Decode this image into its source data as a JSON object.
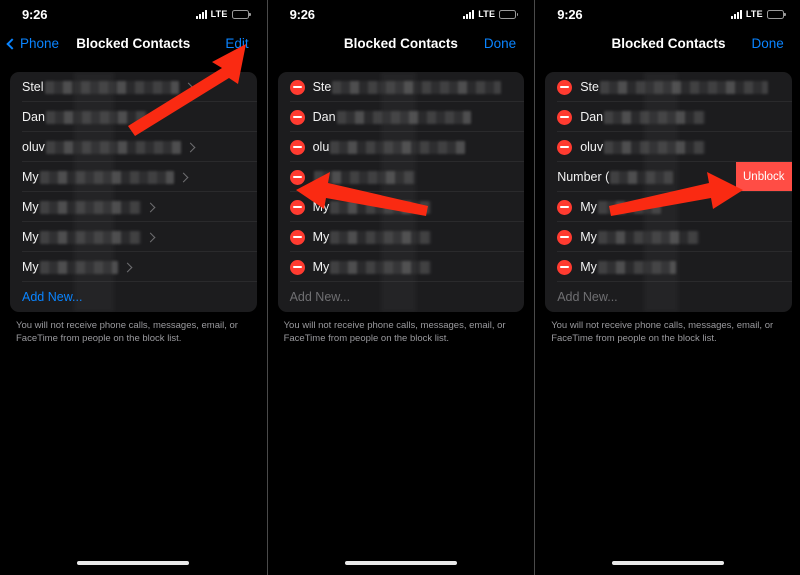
{
  "meta": {
    "panel_count": 3,
    "accent_blue": "#0a84ff",
    "destructive_red": "#ff3b30",
    "unblock_red": "#ff4d45",
    "list_bg": "#1c1c1e",
    "screen_bg": "#000000",
    "annotation_arrow_color": "#fa2a12"
  },
  "status_bar": {
    "time": "9:26",
    "network": "LTE",
    "signal_icon": "cellular-signal-icon",
    "battery_icon": "battery-low-power-icon",
    "battery_level_percent": 48
  },
  "footer_note": "You will not receive phone calls, messages, email, or FaceTime from people on the block list.",
  "panels": [
    {
      "id": "panel-view-mode",
      "nav": {
        "back_label": "Phone",
        "back_icon": "chevron-left-icon",
        "title": "Blocked Contacts",
        "action_label": "Edit",
        "has_back": true
      },
      "edit_mode": false,
      "add_new_label": "Add New...",
      "add_new_enabled": true,
      "rows": [
        {
          "label": "Stel",
          "redacted": true,
          "redact_width": "w60",
          "accessory": "chevron-right-icon"
        },
        {
          "label": "Dan",
          "redacted": true,
          "redact_width": "w45",
          "accessory": "chevron-right-icon"
        },
        {
          "label": "oluv",
          "redacted": true,
          "redact_width": "w60",
          "accessory": "chevron-right-icon"
        },
        {
          "label": "My",
          "redacted": true,
          "redact_width": "w60",
          "accessory": "chevron-right-icon"
        },
        {
          "label": "My",
          "redacted": true,
          "redact_width": "w45",
          "accessory": "chevron-right-icon"
        },
        {
          "label": "My",
          "redacted": true,
          "redact_width": "w45",
          "accessory": "chevron-right-icon"
        },
        {
          "label": "My",
          "redacted": true,
          "redact_width": "w35",
          "accessory": "chevron-right-icon"
        }
      ],
      "annotation": {
        "type": "arrow",
        "points_to": "Edit",
        "direction": "up-right"
      }
    },
    {
      "id": "panel-edit-mode",
      "nav": {
        "back_label": "",
        "back_icon": "",
        "title": "Blocked Contacts",
        "action_label": "Done",
        "has_back": false
      },
      "edit_mode": true,
      "add_new_label": "Add New...",
      "add_new_enabled": false,
      "rows": [
        {
          "label": "Ste",
          "redacted": true,
          "redact_width": "w75",
          "accessory": "delete-minus-icon"
        },
        {
          "label": "Dan",
          "redacted": true,
          "redact_width": "w60",
          "accessory": "delete-minus-icon"
        },
        {
          "label": "olu",
          "redacted": true,
          "redact_width": "w60",
          "accessory": "delete-minus-icon"
        },
        {
          "label": "",
          "redacted": true,
          "redact_width": "w45",
          "accessory": "delete-minus-icon"
        },
        {
          "label": "My",
          "redacted": true,
          "redact_width": "w45",
          "accessory": "delete-minus-icon"
        },
        {
          "label": "My",
          "redacted": true,
          "redact_width": "w45",
          "accessory": "delete-minus-icon"
        },
        {
          "label": "My",
          "redacted": true,
          "redact_width": "w45",
          "accessory": "delete-minus-icon"
        }
      ],
      "annotation": {
        "type": "arrow",
        "points_to": "delete-minus-icon",
        "direction": "left"
      }
    },
    {
      "id": "panel-swipe-unblock",
      "nav": {
        "back_label": "",
        "back_icon": "",
        "title": "Blocked Contacts",
        "action_label": "Done",
        "has_back": false
      },
      "edit_mode": true,
      "add_new_label": "Add New...",
      "add_new_enabled": false,
      "unblock_label": "Unblock",
      "rows": [
        {
          "label": "Ste",
          "redacted": true,
          "redact_width": "w75",
          "accessory": "delete-minus-icon"
        },
        {
          "label": "Dan",
          "redacted": true,
          "redact_width": "w45",
          "accessory": "delete-minus-icon"
        },
        {
          "label": "oluv",
          "redacted": true,
          "redact_width": "w45",
          "accessory": "delete-minus-icon"
        },
        {
          "label": "Number (",
          "redacted": true,
          "redact_width": "w28",
          "accessory": "unblock-button",
          "swiped": true
        },
        {
          "label": "My",
          "redacted": true,
          "redact_width": "w28",
          "accessory": "delete-minus-icon"
        },
        {
          "label": "My",
          "redacted": true,
          "redact_width": "w45",
          "accessory": "delete-minus-icon"
        },
        {
          "label": "My",
          "redacted": true,
          "redact_width": "w35",
          "accessory": "delete-minus-icon"
        }
      ],
      "annotation": {
        "type": "arrow",
        "points_to": "Unblock",
        "direction": "right"
      }
    }
  ]
}
